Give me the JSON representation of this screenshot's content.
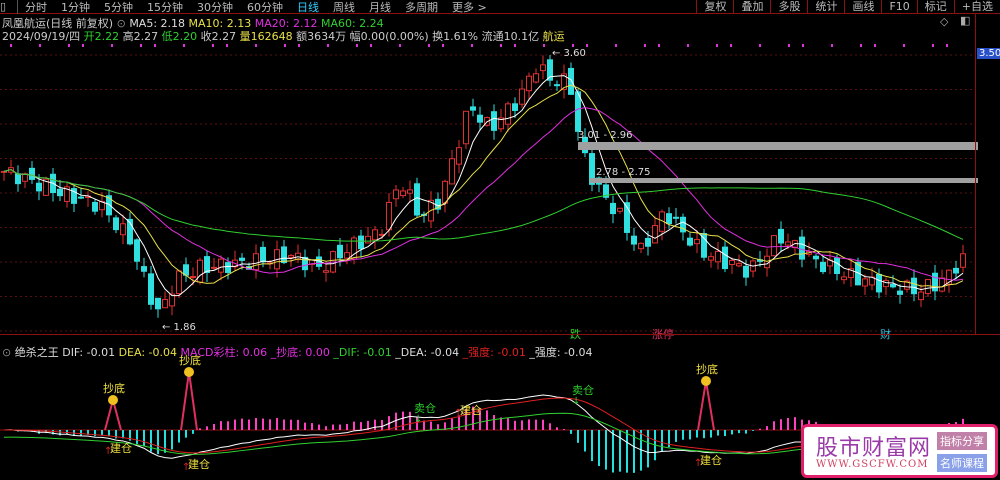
{
  "toolbar": {
    "tabs": [
      "分时",
      "1分钟",
      "5分钟",
      "15分钟",
      "30分钟",
      "60分钟",
      "日线",
      "周线",
      "月线",
      "多周期",
      "更多 >"
    ],
    "active": "日线",
    "right": [
      "复权",
      "叠加",
      "多股",
      "统计",
      "画线",
      "F10",
      "标记",
      "+自选"
    ]
  },
  "header": {
    "title": "凤凰航运(日线 前复权)",
    "ma5": "MA5: 2.18",
    "ma10": "MA10: 2.13",
    "ma20": "MA20: 2.12",
    "ma60": "MA60: 2.24"
  },
  "quote": {
    "date": "2024/09/19/四",
    "open_l": "开",
    "open": "2.22",
    "high_l": "高",
    "high": "2.27",
    "low_l": "低",
    "low": "2.20",
    "close_l": "收",
    "close": "2.27",
    "vol_l": "量",
    "vol": "162648",
    "amt": "额3634万",
    "chg": "幅0.00(0.00%)",
    "turn": "换1.61%",
    "float": "流通10.1亿",
    "name": "航运"
  },
  "price_axis": {
    "top_label": "3.50"
  },
  "annotations": {
    "high": "3.60",
    "low": "1.86",
    "zone1": "3.01 - 2.96",
    "zone2": "2.78 - 2.75",
    "tags": [
      "跌",
      "涨停",
      "财"
    ]
  },
  "indicator": {
    "name": "绝杀之王",
    "dif": "DIF: -0.01",
    "dea": "DEA: -0.04",
    "macd": "MACD彩柱: 0.06",
    "chaodi": "_抄底: 0.00",
    "dif2": "_DIF: -0.01",
    "dea2": "_DEA: -0.04",
    "qd": "_强度: -0.01",
    "qd2": "_强度: -0.04",
    "signals": {
      "buy": "抄底",
      "build": "建仓",
      "sell": "卖仓"
    }
  },
  "watermark": {
    "name": "股市财富网",
    "url": "WWW.GSCFW.COM",
    "b1": "指标分享",
    "b2": "名师课程"
  },
  "colors": {
    "up": "#e03030",
    "down": "#30e0e0",
    "ma5": "#ffffff",
    "ma10": "#e8e048",
    "ma20": "#e030e0",
    "ma60": "#30d030",
    "zone": "#a0a0a0"
  },
  "chart_data": {
    "type": "candlestick",
    "price_range": [
      1.86,
      3.6
    ],
    "keypoints": [
      [
        0,
        2.84
      ],
      [
        20,
        2.8
      ],
      [
        40,
        2.75
      ],
      [
        60,
        2.7
      ],
      [
        100,
        2.62
      ],
      [
        130,
        2.4
      ],
      [
        150,
        2.05
      ],
      [
        160,
        1.92
      ],
      [
        175,
        2.15
      ],
      [
        200,
        2.22
      ],
      [
        240,
        2.25
      ],
      [
        290,
        2.3
      ],
      [
        320,
        2.22
      ],
      [
        350,
        2.35
      ],
      [
        380,
        2.45
      ],
      [
        400,
        2.78
      ],
      [
        420,
        2.55
      ],
      [
        440,
        2.65
      ],
      [
        470,
        3.25
      ],
      [
        490,
        3.1
      ],
      [
        520,
        3.3
      ],
      [
        535,
        3.5
      ],
      [
        555,
        3.4
      ],
      [
        570,
        3.4
      ],
      [
        580,
        3.0
      ],
      [
        595,
        2.75
      ],
      [
        620,
        2.55
      ],
      [
        640,
        2.32
      ],
      [
        665,
        2.58
      ],
      [
        700,
        2.33
      ],
      [
        750,
        2.2
      ],
      [
        780,
        2.42
      ],
      [
        820,
        2.25
      ],
      [
        850,
        2.17
      ],
      [
        890,
        2.1
      ],
      [
        920,
        2.08
      ],
      [
        945,
        2.15
      ],
      [
        960,
        2.27
      ]
    ]
  }
}
